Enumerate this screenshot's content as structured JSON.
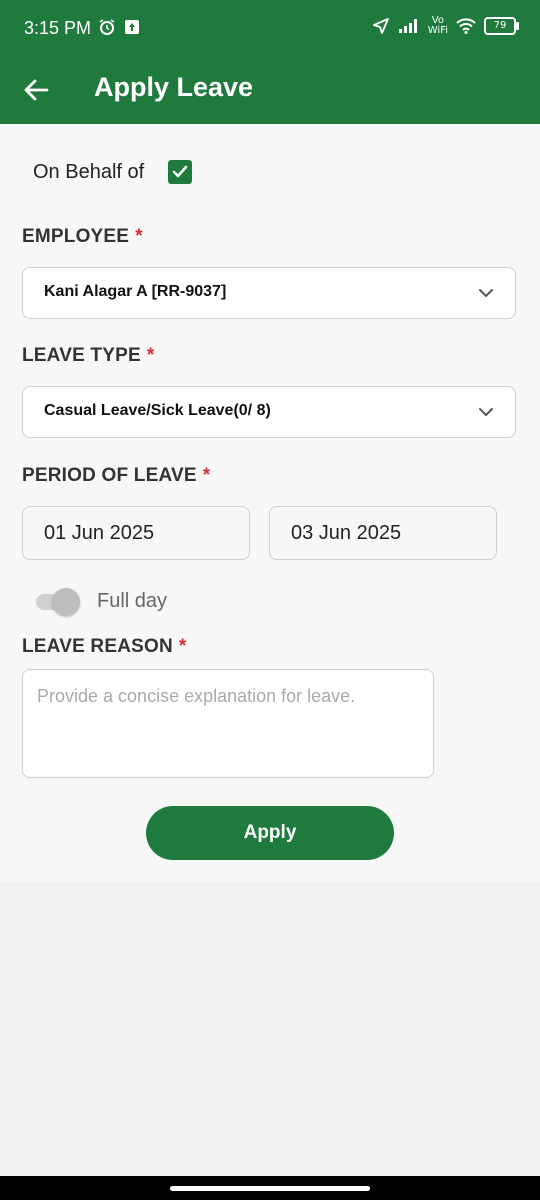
{
  "status_bar": {
    "time": "3:15 PM",
    "vo": "Vo",
    "wifi_text": "WiFi",
    "battery": "79"
  },
  "app_bar": {
    "title": "Apply Leave"
  },
  "form": {
    "on_behalf_label": "On Behalf of",
    "on_behalf_checked": true,
    "employee_label": "EMPLOYEE",
    "employee_value": "Kani Alagar A [RR-9037]",
    "leave_type_label": "LEAVE TYPE",
    "leave_type_value": "Casual Leave/Sick Leave(0/ 8)",
    "period_label": "PERIOD OF LEAVE",
    "from_date": "01 Jun 2025",
    "to_date": "03 Jun 2025",
    "full_day_label": "Full day",
    "full_day_on": false,
    "reason_label": "LEAVE REASON",
    "reason_placeholder": "Provide a concise explanation for leave.",
    "required_mark": "*",
    "apply_label": "Apply"
  },
  "colors": {
    "primary": "#1f7a3d",
    "required": "#d32f2f"
  }
}
